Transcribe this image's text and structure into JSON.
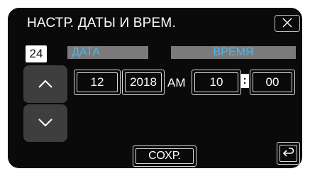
{
  "header": {
    "title": "НАСТР. ДАТЫ И ВРЕМ.",
    "close_icon": "close-icon"
  },
  "selector": {
    "day": "24",
    "up_icon": "chevron-up-icon",
    "down_icon": "chevron-down-icon"
  },
  "labels": {
    "date": "ДАТА",
    "time": "ВРЕМЯ",
    "label_color": "#4fb7ea"
  },
  "fields": {
    "month": "12",
    "year": "2018",
    "ampm": "AM",
    "hour": "10",
    "separator": ":",
    "minute": "00"
  },
  "footer": {
    "save_label": "СОХР.",
    "back_icon": "return-icon"
  }
}
